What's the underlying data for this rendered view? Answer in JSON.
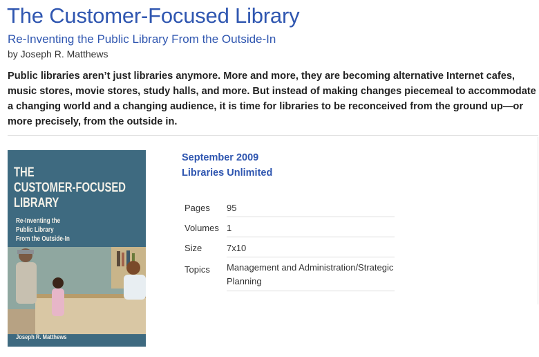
{
  "book": {
    "title": "The Customer-Focused Library",
    "subtitle": "Re-Inventing the Public Library From the Outside-In",
    "byline": "by Joseph R. Matthews",
    "description": "Public libraries aren’t just libraries anymore. More and more, they are becoming alternative Internet cafes, music stores, movie stores, study halls, and more. But instead of making changes piecemeal to accommodate a changing world and a changing audience, it is time for libraries to be reconceived from the ground up—or more precisely, from the outside in.",
    "pub_date": "September 2009",
    "publisher": "Libraries Unlimited"
  },
  "cover": {
    "title_line1": "THE",
    "title_line2": "CUSTOMER-FOCUSED",
    "title_line3": "LIBRARY",
    "sub_line1": "Re-Inventing the",
    "sub_line2": "Public Library",
    "sub_line3": "From the Outside-In",
    "author": "Joseph R. Matthews",
    "bg_color": "#3e6a80"
  },
  "details": [
    {
      "label": "Pages",
      "value": "95"
    },
    {
      "label": "Volumes",
      "value": "1"
    },
    {
      "label": "Size",
      "value": "7x10"
    },
    {
      "label": "Topics",
      "value": "Management and Administration/Strategic Planning"
    }
  ],
  "colors": {
    "accent": "#2f56b0"
  }
}
